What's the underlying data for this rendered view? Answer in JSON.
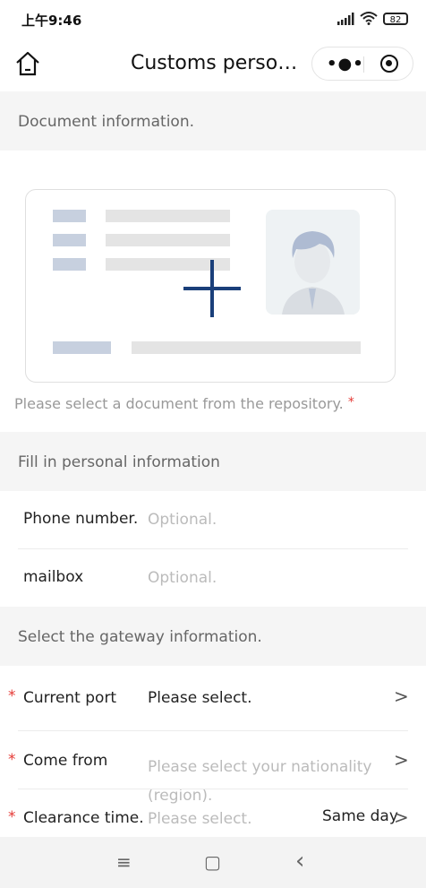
{
  "status_bar": {
    "time": "上午9:46",
    "battery": "82"
  },
  "nav": {
    "title": "Customs perso…",
    "more_label": "•●•"
  },
  "document_section": {
    "header": "Document information.",
    "hint": "Please select a document from the repository.",
    "required_mark": "*"
  },
  "personal_section": {
    "header": "Fill in personal information",
    "fields": [
      {
        "label": "Phone number.",
        "placeholder": "Optional."
      },
      {
        "label": "mailbox",
        "placeholder": "Optional."
      }
    ]
  },
  "gateway_section": {
    "header": "Select the gateway information.",
    "fields": [
      {
        "label": "Current port",
        "value": "Please select.",
        "required": "*"
      },
      {
        "label": "Come from",
        "placeholder": "Please select your nationality (region).",
        "required": "*"
      },
      {
        "label": "Clearance time.",
        "placeholder": "Please select.",
        "extra": "Same day",
        "required": "*"
      }
    ]
  },
  "system_nav": {
    "menu": "≡",
    "home": "▢",
    "back": "‹"
  },
  "colors": {
    "accent": "#1a3f7a",
    "required": "#e53935",
    "section_bg": "#f5f5f5"
  }
}
